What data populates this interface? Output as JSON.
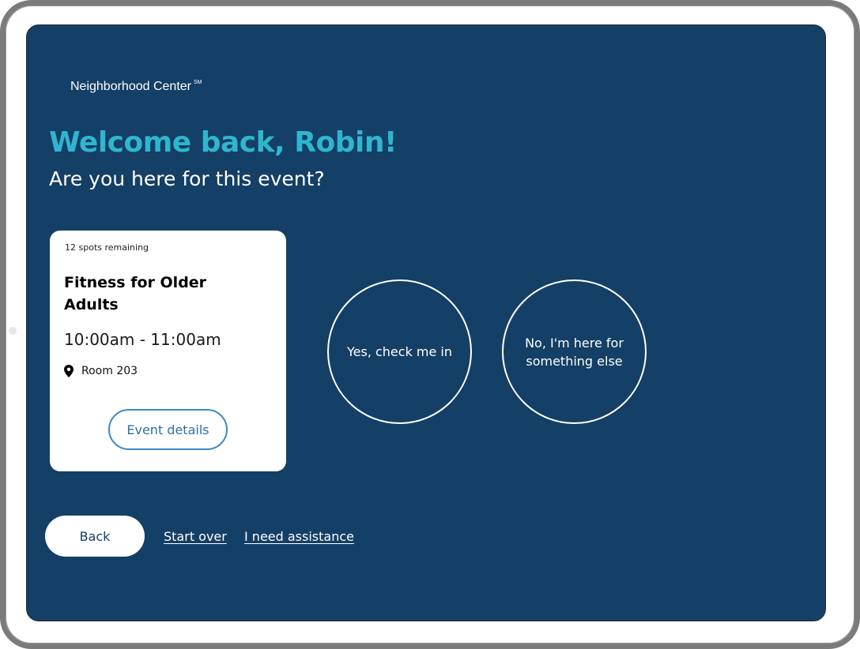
{
  "header": {
    "brand_name": "Neighborhood Center",
    "brand_mark": "SM"
  },
  "greeting": {
    "title": "Welcome back, Robin!",
    "question": "Are you here for this event?"
  },
  "event_card": {
    "spots_remaining": "12 spots remaining",
    "title": "Fitness for Older Adults",
    "time": "10:00am - 11:00am",
    "location_icon": "map-pin-icon",
    "location": "Room 203",
    "details_label": "Event details"
  },
  "choices": {
    "yes_label": "Yes, check me in",
    "no_label": "No, I'm here for something else"
  },
  "footer": {
    "back_label": "Back",
    "start_over_label": "Start over",
    "assistance_label": "I need assistance"
  },
  "colors": {
    "screen_background": "#143f66",
    "accent": "#2fb6cf",
    "button_outline": "#3a87c7"
  }
}
